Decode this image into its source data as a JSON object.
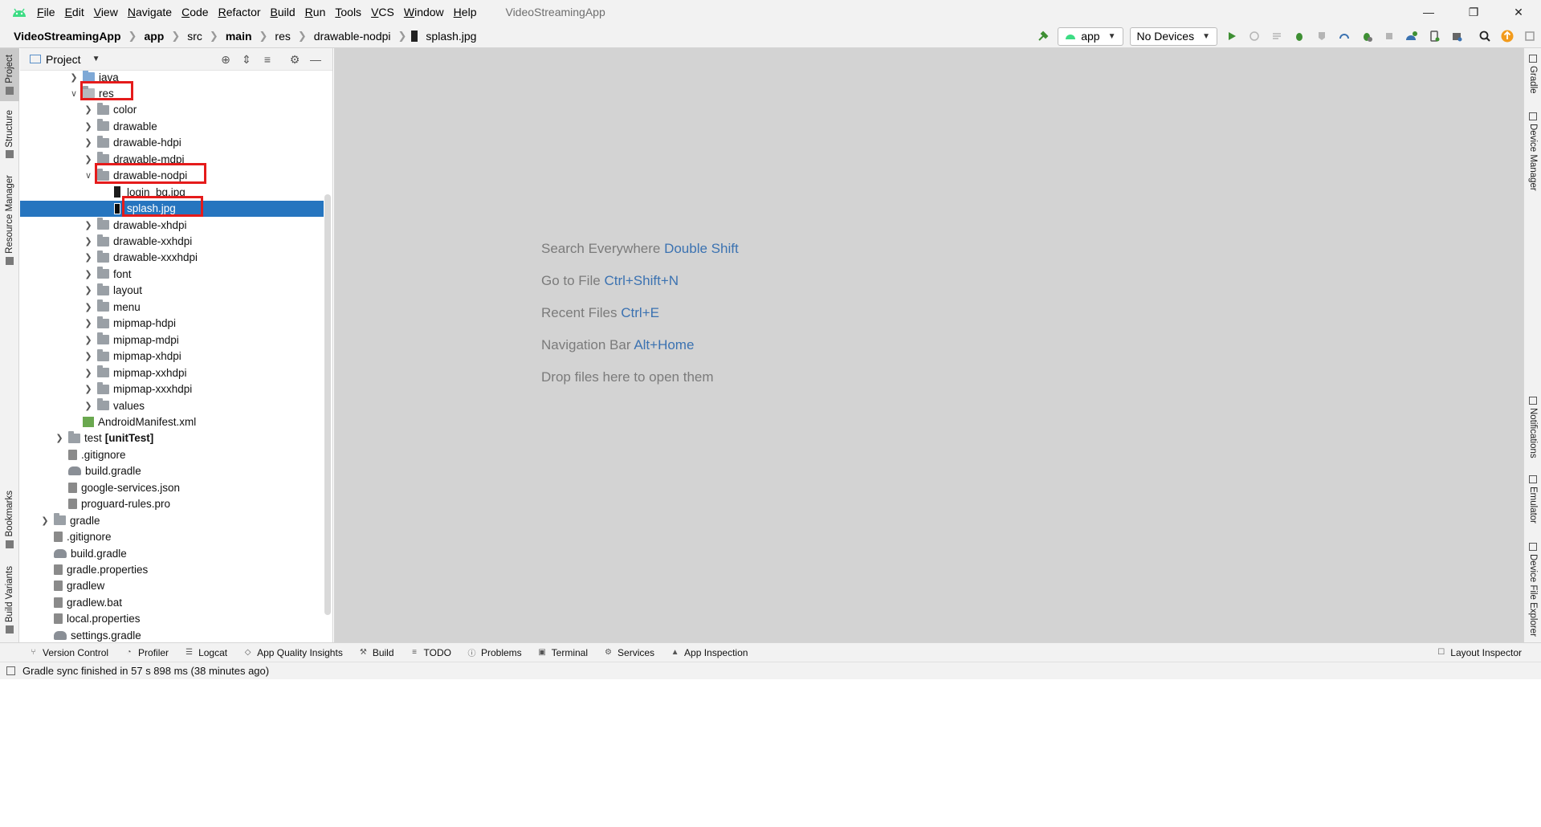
{
  "app": {
    "window_title": "VideoStreamingApp"
  },
  "menu": [
    "File",
    "Edit",
    "View",
    "Navigate",
    "Code",
    "Refactor",
    "Build",
    "Run",
    "Tools",
    "VCS",
    "Window",
    "Help"
  ],
  "breadcrumb": {
    "project": "VideoStreamingApp",
    "module": "app",
    "src": "src",
    "main": "main",
    "res": "res",
    "folder": "drawable-nodpi",
    "file": "splash.jpg"
  },
  "toolbar": {
    "config": "app",
    "device": "No Devices"
  },
  "left_tabs": {
    "project": "Project",
    "structure": "Structure",
    "resource_manager": "Resource Manager",
    "bookmarks": "Bookmarks",
    "build_variants": "Build Variants"
  },
  "right_tabs": {
    "gradle": "Gradle",
    "device_manager": "Device Manager",
    "notifications": "Notifications",
    "emulator": "Emulator",
    "device_file_explorer": "Device File Explorer"
  },
  "project_panel": {
    "title": "Project"
  },
  "tree": [
    {
      "label": "java",
      "type": "folder-blue",
      "depth": 4,
      "expand": "closed"
    },
    {
      "label": "res",
      "type": "folder-res",
      "depth": 4,
      "expand": "open"
    },
    {
      "label": "color",
      "type": "folder",
      "depth": 5,
      "expand": "closed"
    },
    {
      "label": "drawable",
      "type": "folder",
      "depth": 5,
      "expand": "closed"
    },
    {
      "label": "drawable-hdpi",
      "type": "folder",
      "depth": 5,
      "expand": "closed"
    },
    {
      "label": "drawable-mdpi",
      "type": "folder",
      "depth": 5,
      "expand": "closed"
    },
    {
      "label": "drawable-nodpi",
      "type": "folder",
      "depth": 5,
      "expand": "open"
    },
    {
      "label": "login_bg.jpg",
      "type": "img",
      "depth": 6,
      "expand": "none"
    },
    {
      "label": "splash.jpg",
      "type": "img",
      "depth": 6,
      "expand": "none",
      "selected": true
    },
    {
      "label": "drawable-xhdpi",
      "type": "folder",
      "depth": 5,
      "expand": "closed"
    },
    {
      "label": "drawable-xxhdpi",
      "type": "folder",
      "depth": 5,
      "expand": "closed"
    },
    {
      "label": "drawable-xxxhdpi",
      "type": "folder",
      "depth": 5,
      "expand": "closed"
    },
    {
      "label": "font",
      "type": "folder",
      "depth": 5,
      "expand": "closed"
    },
    {
      "label": "layout",
      "type": "folder",
      "depth": 5,
      "expand": "closed"
    },
    {
      "label": "menu",
      "type": "folder",
      "depth": 5,
      "expand": "closed"
    },
    {
      "label": "mipmap-hdpi",
      "type": "folder",
      "depth": 5,
      "expand": "closed"
    },
    {
      "label": "mipmap-mdpi",
      "type": "folder",
      "depth": 5,
      "expand": "closed"
    },
    {
      "label": "mipmap-xhdpi",
      "type": "folder",
      "depth": 5,
      "expand": "closed"
    },
    {
      "label": "mipmap-xxhdpi",
      "type": "folder",
      "depth": 5,
      "expand": "closed"
    },
    {
      "label": "mipmap-xxxhdpi",
      "type": "folder",
      "depth": 5,
      "expand": "closed"
    },
    {
      "label": "values",
      "type": "folder",
      "depth": 5,
      "expand": "closed"
    },
    {
      "label": "AndroidManifest.xml",
      "type": "manifest",
      "depth": 4,
      "expand": "none"
    },
    {
      "label": "test",
      "suffix": "[unitTest]",
      "type": "folder",
      "depth": 3,
      "expand": "closed"
    },
    {
      "label": ".gitignore",
      "type": "file",
      "depth": 3,
      "expand": "none"
    },
    {
      "label": "build.gradle",
      "type": "gradle",
      "depth": 3,
      "expand": "none"
    },
    {
      "label": "google-services.json",
      "type": "file",
      "depth": 3,
      "expand": "none"
    },
    {
      "label": "proguard-rules.pro",
      "type": "file",
      "depth": 3,
      "expand": "none"
    },
    {
      "label": "gradle",
      "type": "folder",
      "depth": 2,
      "expand": "closed"
    },
    {
      "label": ".gitignore",
      "type": "file",
      "depth": 2,
      "expand": "none"
    },
    {
      "label": "build.gradle",
      "type": "gradle",
      "depth": 2,
      "expand": "none"
    },
    {
      "label": "gradle.properties",
      "type": "file",
      "depth": 2,
      "expand": "none"
    },
    {
      "label": "gradlew",
      "type": "file",
      "depth": 2,
      "expand": "none"
    },
    {
      "label": "gradlew.bat",
      "type": "file",
      "depth": 2,
      "expand": "none"
    },
    {
      "label": "local.properties",
      "type": "file",
      "depth": 2,
      "expand": "none"
    },
    {
      "label": "settings.gradle",
      "type": "gradle",
      "depth": 2,
      "expand": "none"
    }
  ],
  "editor_hints": [
    {
      "text": "Search Everywhere",
      "key": "Double Shift"
    },
    {
      "text": "Go to File",
      "key": "Ctrl+Shift+N"
    },
    {
      "text": "Recent Files",
      "key": "Ctrl+E"
    },
    {
      "text": "Navigation Bar",
      "key": "Alt+Home"
    },
    {
      "text": "Drop files here to open them",
      "key": ""
    }
  ],
  "bottom_tabs": [
    "Version Control",
    "Profiler",
    "Logcat",
    "App Quality Insights",
    "Build",
    "TODO",
    "Problems",
    "Terminal",
    "Services",
    "App Inspection"
  ],
  "layout_inspector": "Layout Inspector",
  "status": "Gradle sync finished in 57 s 898 ms (38 minutes ago)",
  "colors": {
    "selection": "#2675bf",
    "highlight_box": "#e51b1b",
    "editor_bg": "#d3d3d3",
    "link": "#3b72b1"
  }
}
